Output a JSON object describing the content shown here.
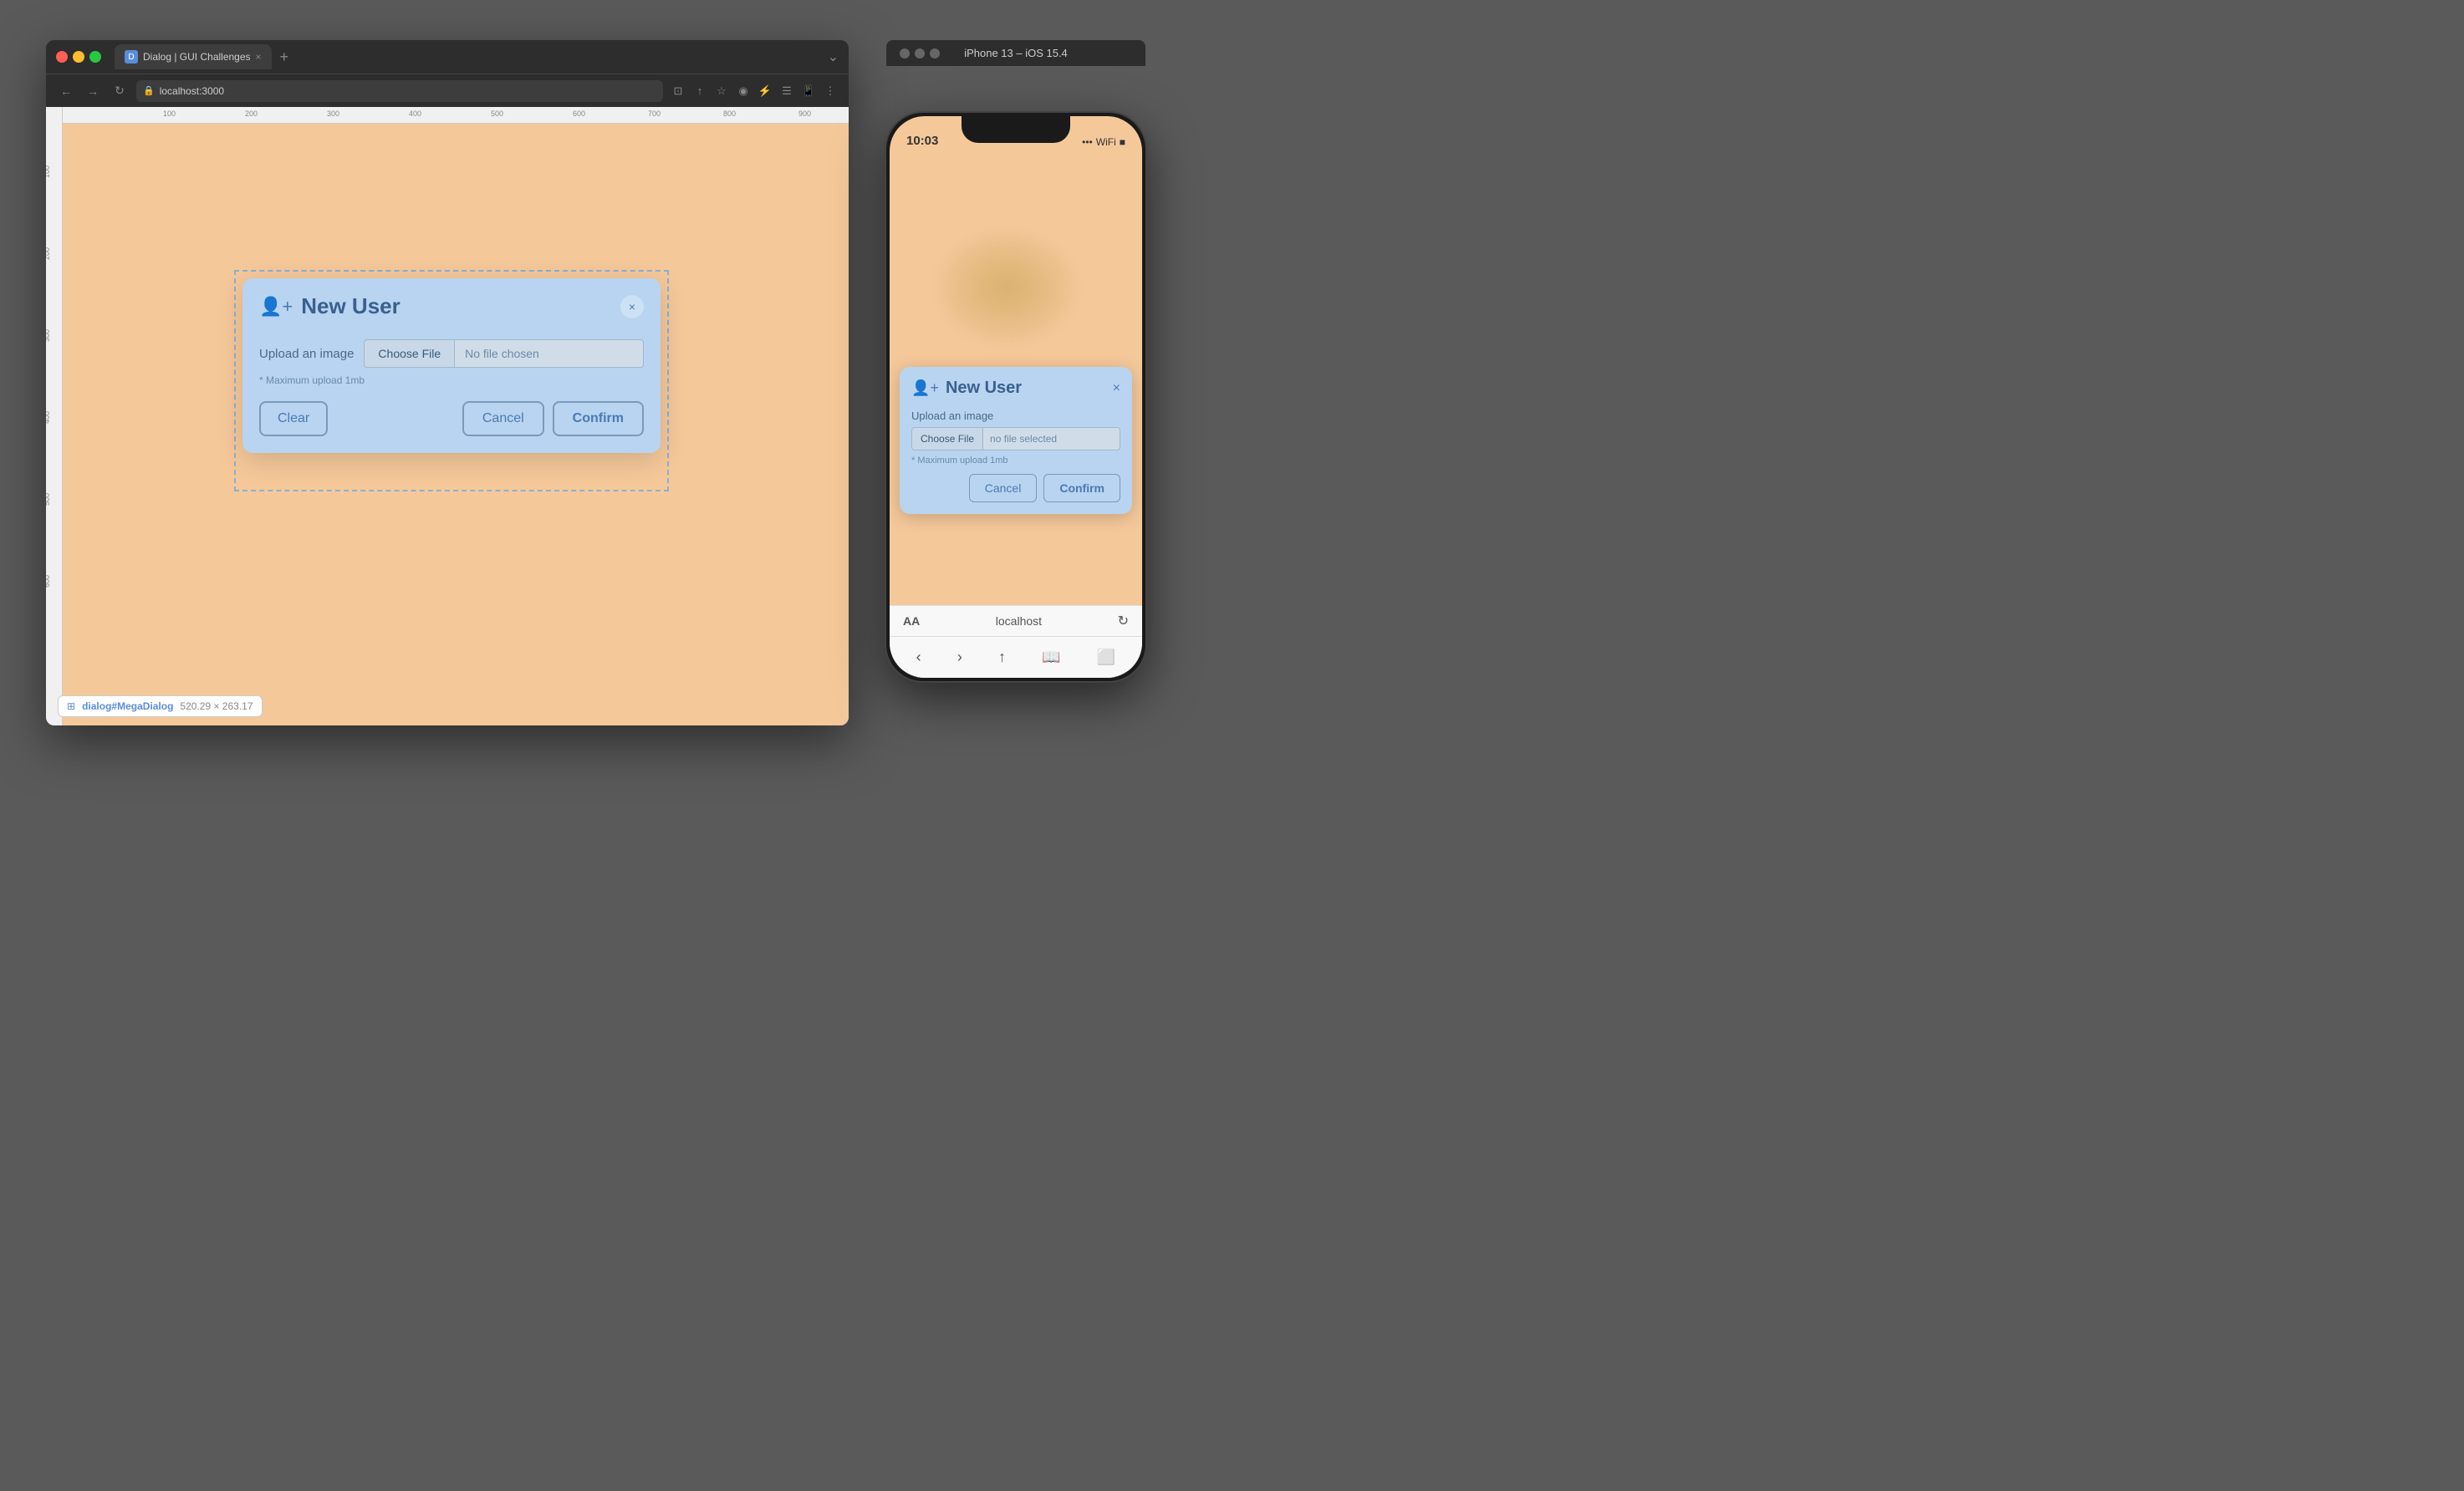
{
  "browser": {
    "tab_title": "Dialog | GUI Challenges",
    "tab_close": "×",
    "tab_new": "+",
    "address": "localhost:3000",
    "window_controls": "⌄"
  },
  "dialog": {
    "title": "New User",
    "close_label": "×",
    "upload_label": "Upload an image",
    "choose_file_label": "Choose File",
    "no_file_label": "No file chosen",
    "upload_hint": "* Maximum upload 1mb",
    "clear_label": "Clear",
    "cancel_label": "Cancel",
    "confirm_label": "Confirm"
  },
  "phone": {
    "title": "iPhone 13 – iOS 15.4",
    "time": "10:03",
    "signal": "...",
    "wifi": "WiFi",
    "battery": "🔋",
    "dialog_title": "New User",
    "dialog_close": "×",
    "upload_label": "Upload an image",
    "choose_file_label": "Choose File",
    "no_file_label": "no file selected",
    "upload_hint": "* Maximum upload 1mb",
    "cancel_label": "Cancel",
    "confirm_label": "Confirm",
    "safari_url": "localhost",
    "safari_aa": "AA"
  },
  "bottom_info": {
    "element": "dialog#MegaDialog",
    "size": "520.29 × 263.17"
  },
  "ruler": {
    "ticks_h": [
      "100",
      "200",
      "300",
      "400",
      "500",
      "600",
      "700",
      "800",
      "900"
    ],
    "ticks_v": [
      "100",
      "200",
      "300",
      "400",
      "500",
      "600"
    ]
  }
}
